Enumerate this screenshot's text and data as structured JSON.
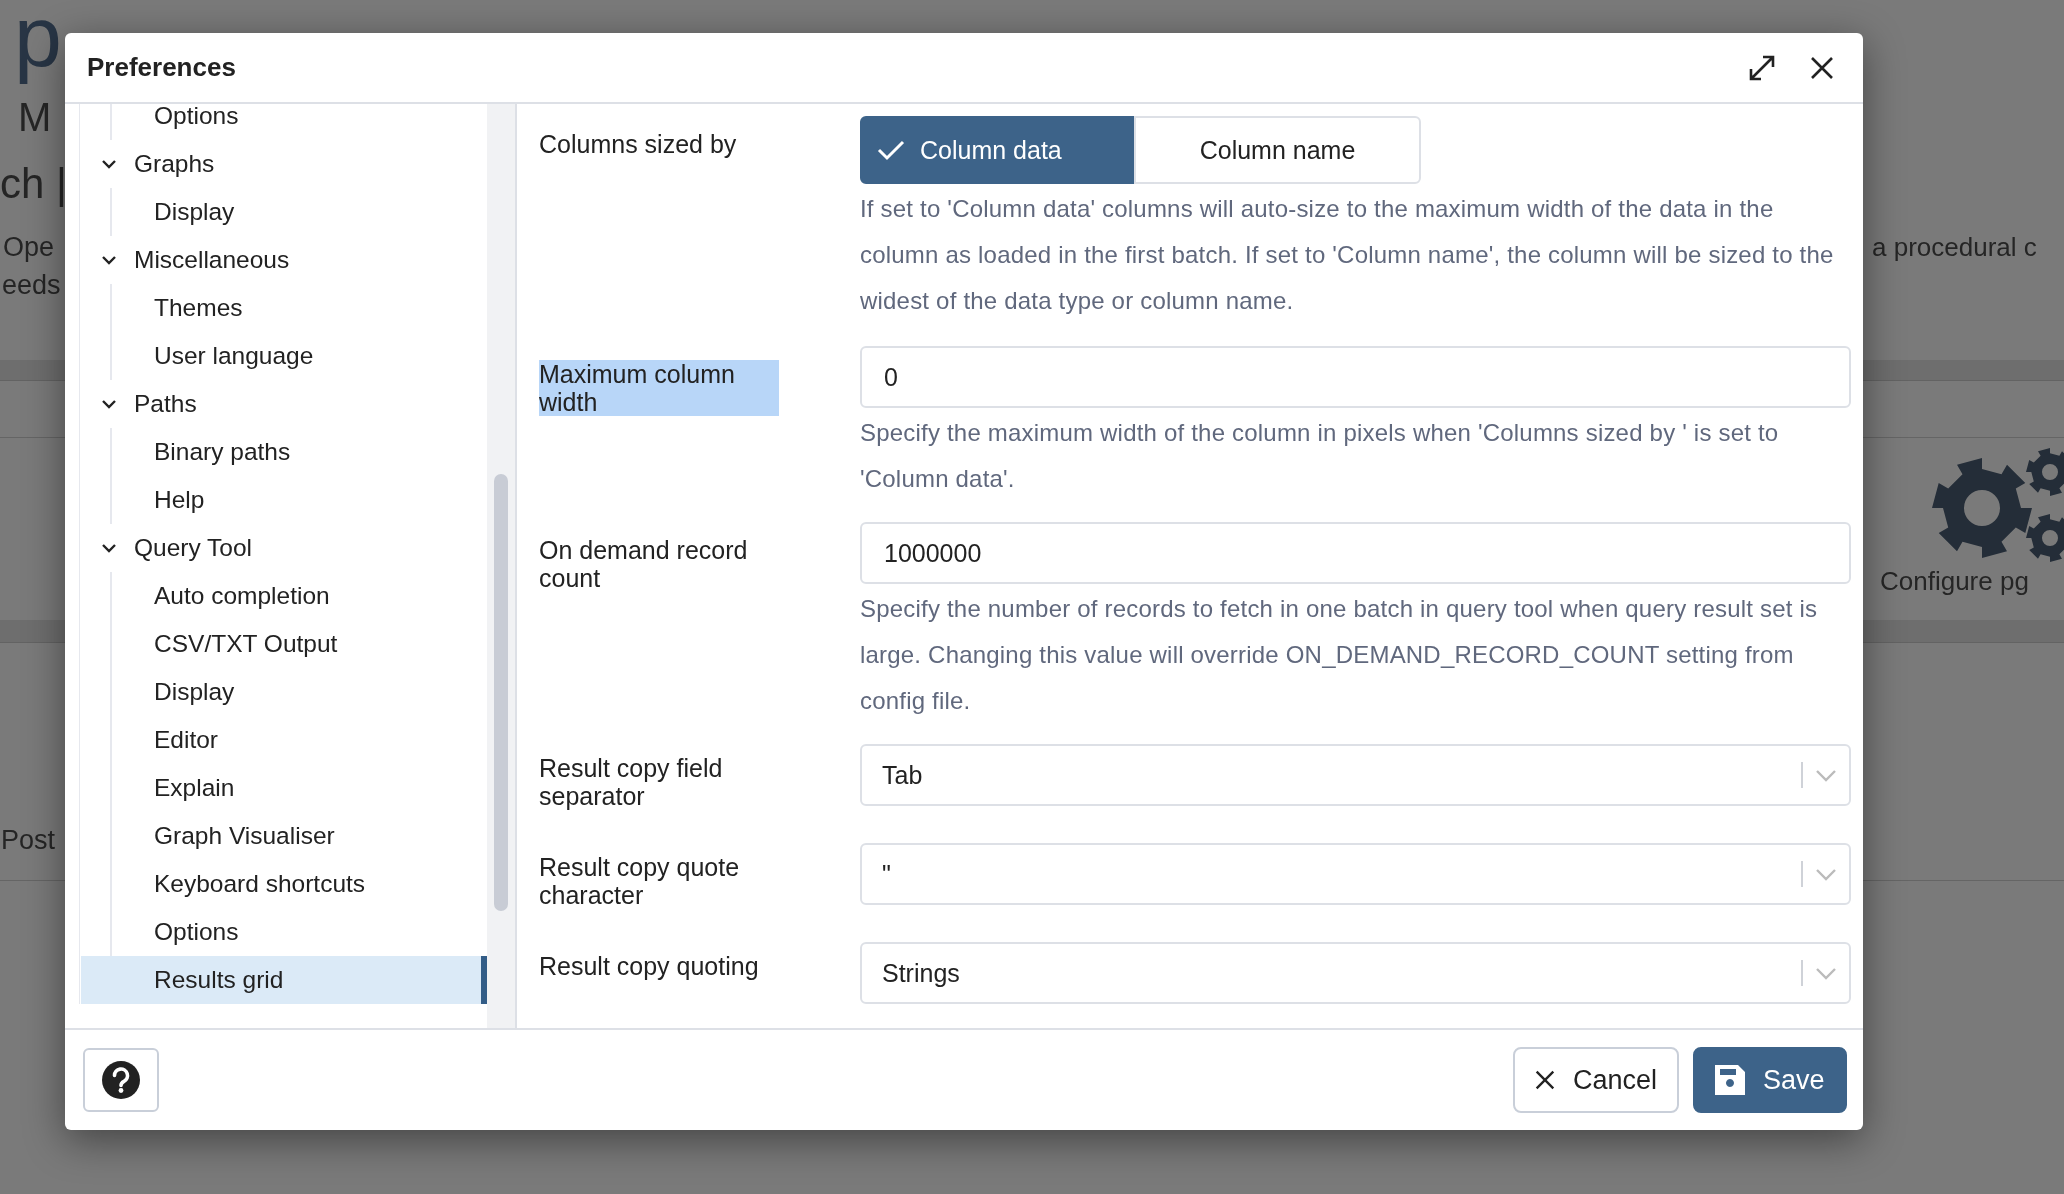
{
  "background_page": {
    "title": "p",
    "texts": [
      "M",
      "ch |",
      "Ope",
      "eeds",
      "Post",
      "a procedural c",
      "Configure pg"
    ]
  },
  "dialog": {
    "title": "Preferences",
    "tree": [
      {
        "children": [
          {
            "label": "Options",
            "selected": false
          }
        ]
      },
      {
        "label": "Graphs",
        "expanded": true,
        "children": [
          {
            "label": "Display",
            "selected": false
          }
        ]
      },
      {
        "label": "Miscellaneous",
        "expanded": true,
        "children": [
          {
            "label": "Themes",
            "selected": false
          },
          {
            "label": "User language",
            "selected": false
          }
        ]
      },
      {
        "label": "Paths",
        "expanded": true,
        "children": [
          {
            "label": "Binary paths",
            "selected": false
          },
          {
            "label": "Help",
            "selected": false
          }
        ]
      },
      {
        "label": "Query Tool",
        "expanded": true,
        "children": [
          {
            "label": "Auto completion",
            "selected": false
          },
          {
            "label": "CSV/TXT Output",
            "selected": false
          },
          {
            "label": "Display",
            "selected": false
          },
          {
            "label": "Editor",
            "selected": false
          },
          {
            "label": "Explain",
            "selected": false
          },
          {
            "label": "Graph Visualiser",
            "selected": false
          },
          {
            "label": "Keyboard shortcuts",
            "selected": false
          },
          {
            "label": "Options",
            "selected": false
          },
          {
            "label": "Results grid",
            "selected": true
          }
        ]
      }
    ],
    "fields": [
      {
        "kind": "toggle",
        "label": "Columns sized by",
        "highlighted": false,
        "options": [
          {
            "label": "Column data",
            "selected": true
          },
          {
            "label": "Column name",
            "selected": false
          }
        ],
        "help": "If set to 'Column data' columns will auto-size to the maximum width of the data in the column as loaded in the first batch. If set to 'Column name', the column will be sized to the widest of the data type or column name."
      },
      {
        "kind": "text",
        "label": "Maximum column width",
        "highlighted": true,
        "value": "0",
        "help": "Specify the maximum width of the column in pixels when 'Columns sized by ' is set to 'Column data'."
      },
      {
        "kind": "text",
        "label": "On demand record count",
        "highlighted": false,
        "value": "1000000",
        "help": "Specify the number of records to fetch in one batch in query tool when query result set is large. Changing this value will override ON_DEMAND_RECORD_COUNT setting from config file."
      },
      {
        "kind": "select",
        "label": "Result copy field separator",
        "highlighted": false,
        "value": "Tab"
      },
      {
        "kind": "select",
        "label": "Result copy quote character",
        "highlighted": false,
        "value": "\""
      },
      {
        "kind": "select",
        "label": "Result copy quoting",
        "highlighted": false,
        "value": "Strings"
      }
    ],
    "buttons": [
      {
        "kind": "cancel",
        "label": "Cancel"
      },
      {
        "kind": "save",
        "label": "Save"
      }
    ]
  }
}
